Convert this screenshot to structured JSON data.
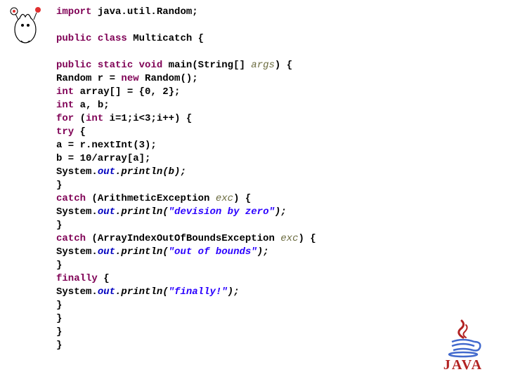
{
  "code": {
    "l1_kw": "import",
    "l1_rest": " java.util.Random;",
    "l3_kw1": "public",
    "l3_kw2": "class",
    "l3_name": " Multicatch {",
    "l5_kw1": "public",
    "l5_kw2": "static",
    "l5_kw3": "void",
    "l5_name": " main(String[] ",
    "l5_arg": "args",
    "l5_end": ") {",
    "l6_a": "Random r = ",
    "l6_kw": "new",
    "l6_b": " Random();",
    "l7_kw": "int",
    "l7_rest": " array[] = {0, 2};",
    "l8_kw": "int",
    "l8_rest": " a, b;",
    "l9_kw1": "for",
    "l9_a": " (",
    "l9_kw2": "int",
    "l9_b": " i=1;i<3;i++) {",
    "l10_kw": "try",
    "l10_rest": " {",
    "l11": "a = r.nextInt(3);",
    "l12": "b = 10/array[a];",
    "l13_a": "System.",
    "l13_out": "out",
    "l13_call": ".println(b);",
    "l14": "}",
    "l15_kw": "catch",
    "l15_a": " (ArithmeticException ",
    "l15_exc": "exc",
    "l15_b": ") {",
    "l16_a": "System.",
    "l16_out": "out",
    "l16_call": ".println(",
    "l16_str": "\"devision by zero\"",
    "l16_end": ");",
    "l17": "}",
    "l18_kw": "catch",
    "l18_a": " (ArrayIndexOutOfBoundsException ",
    "l18_exc": "exc",
    "l18_b": ") {",
    "l19_a": "System.",
    "l19_out": "out",
    "l19_call": ".println(",
    "l19_str": "\"out of bounds\"",
    "l19_end": ");",
    "l20": "}",
    "l21_kw": "finally",
    "l21_rest": " {",
    "l22_a": "System.",
    "l22_out": "out",
    "l22_call": ".println(",
    "l22_str": "\"finally!\"",
    "l22_end": ");",
    "l23": "}",
    "l24": "}",
    "l25": "}",
    "l26": "}"
  },
  "logo": {
    "text": "JAVA"
  }
}
